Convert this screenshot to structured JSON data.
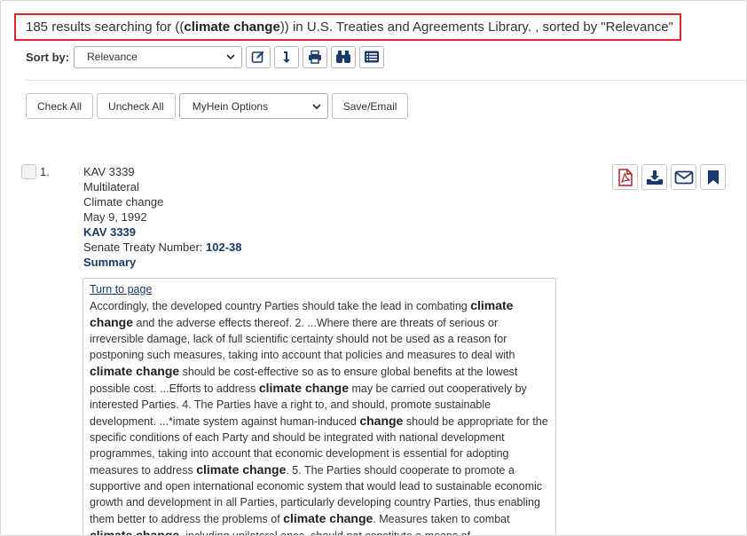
{
  "summary": {
    "count_text": "185 results searching for ((",
    "query": "climate change",
    "after_query": ")) in U.S. Treaties and Agreements Library. , sorted by \"Relevance\""
  },
  "sort": {
    "label": "Sort by:",
    "selected": "Relevance"
  },
  "toolbar": {
    "icons": [
      "edit-icon",
      "sort-arrow-icon",
      "print-icon",
      "binoculars-icon",
      "list-view-icon"
    ]
  },
  "actions": {
    "check_all": "Check All",
    "uncheck_all": "Uncheck All",
    "myhein_selected": "MyHein Options",
    "save_email": "Save/Email"
  },
  "results": [
    {
      "number": "1.",
      "id": "KAV 3339",
      "party": "Multilateral",
      "subject": "Climate change",
      "date": "May 9, 1992",
      "link_id": "KAV 3339",
      "treaty_label": "Senate Treaty Number: ",
      "treaty_number": "102-38",
      "summary_link": "Summary",
      "snippet_link": "Turn to page",
      "snippet": [
        {
          "t": "Accordingly, the developed country Parties should take the lead in combating "
        },
        {
          "t": "climate change",
          "hl": true
        },
        {
          "t": " and the adverse effects thereof. 2. ...Where there are threats of serious or irreversible damage, lack of full scientific certainty should not be used as a reason for postponing such measures, taking into account that policies and measures to deal with "
        },
        {
          "t": "climate change",
          "hl": true
        },
        {
          "t": " should be cost-effective so as to ensure global benefits at the lowest possible cost. ...Efforts to address "
        },
        {
          "t": "climate change",
          "hl": true
        },
        {
          "t": " may be carried out cooperatively by interested Parties. 4. The Parties have a right to, and should, promote sustainable development. ...*imate system against human-induced "
        },
        {
          "t": "change",
          "hl": true
        },
        {
          "t": " should be appropriate for the specific conditions of each Party and should be integrated with national development programmes, taking into account that economic development is essential for adopting measures to address "
        },
        {
          "t": "climate change",
          "hl": true
        },
        {
          "t": ". 5. The Parties should cooperate to promote a supportive and open international economic system that would lead to sustainable economic growth and development in all Parties, particularly developing country Parties, thus enabling them better to address the problems of "
        },
        {
          "t": "climate change",
          "hl": true
        },
        {
          "t": ". Measures taken to combat "
        },
        {
          "t": "climate change",
          "hl": true
        },
        {
          "t": ", including unilateral ones, should not constitute a means of"
        }
      ],
      "action_icons": [
        "pdf-icon",
        "download-icon",
        "email-icon",
        "bookmark-icon"
      ]
    }
  ],
  "colors": {
    "highlight_border": "#e0262d",
    "link": "#1a3a6b",
    "pdf": "#b22222"
  }
}
